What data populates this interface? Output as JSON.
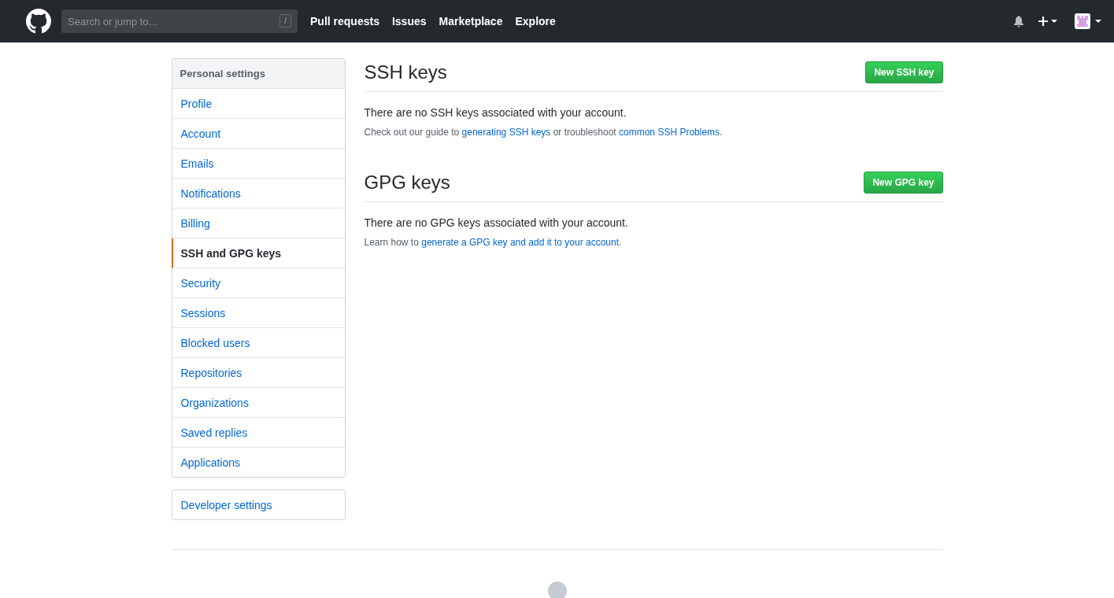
{
  "header": {
    "search": {
      "placeholder": "Search or jump to…",
      "shortcut": "/"
    },
    "nav": [
      "Pull requests",
      "Issues",
      "Marketplace",
      "Explore"
    ]
  },
  "sidebar": {
    "heading": "Personal settings",
    "items": [
      {
        "label": "Profile",
        "selected": false
      },
      {
        "label": "Account",
        "selected": false
      },
      {
        "label": "Emails",
        "selected": false
      },
      {
        "label": "Notifications",
        "selected": false
      },
      {
        "label": "Billing",
        "selected": false
      },
      {
        "label": "SSH and GPG keys",
        "selected": true
      },
      {
        "label": "Security",
        "selected": false
      },
      {
        "label": "Sessions",
        "selected": false
      },
      {
        "label": "Blocked users",
        "selected": false
      },
      {
        "label": "Repositories",
        "selected": false
      },
      {
        "label": "Organizations",
        "selected": false
      },
      {
        "label": "Saved replies",
        "selected": false
      },
      {
        "label": "Applications",
        "selected": false
      }
    ],
    "developer": "Developer settings"
  },
  "sections": [
    {
      "title": "SSH keys",
      "button": "New SSH key",
      "message": "There are no SSH keys associated with your account.",
      "note": [
        {
          "kind": "text",
          "text": "Check out our guide to "
        },
        {
          "kind": "link",
          "text": "generating SSH keys"
        },
        {
          "kind": "text",
          "text": " or troubleshoot "
        },
        {
          "kind": "link",
          "text": "common SSH Problems"
        },
        {
          "kind": "text",
          "text": "."
        }
      ]
    },
    {
      "title": "GPG keys",
      "button": "New GPG key",
      "message": "There are no GPG keys associated with your account.",
      "note": [
        {
          "kind": "text",
          "text": "Learn how to "
        },
        {
          "kind": "link",
          "text": "generate a GPG key and add it to your account"
        },
        {
          "kind": "text",
          "text": "."
        }
      ]
    }
  ]
}
